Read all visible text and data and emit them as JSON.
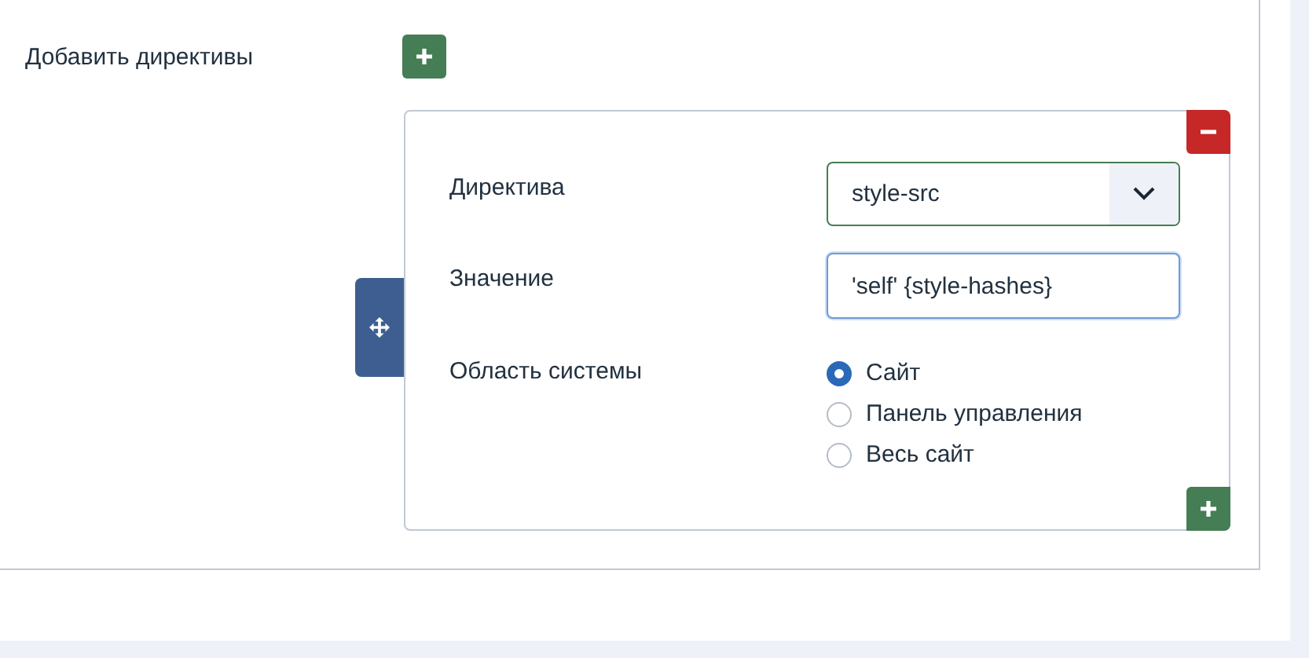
{
  "add_directives_label": "Добавить директивы",
  "directive": {
    "fields": [
      {
        "kind": "select",
        "label": "Директива",
        "value": "style-src"
      },
      {
        "kind": "text",
        "label": "Значение",
        "value": "'self' {style-hashes}"
      },
      {
        "kind": "radio",
        "label": "Область системы",
        "options": [
          {
            "label": "Сайт",
            "selected": true
          },
          {
            "label": "Панель управления",
            "selected": false
          },
          {
            "label": "Весь сайт",
            "selected": false
          }
        ]
      }
    ]
  }
}
